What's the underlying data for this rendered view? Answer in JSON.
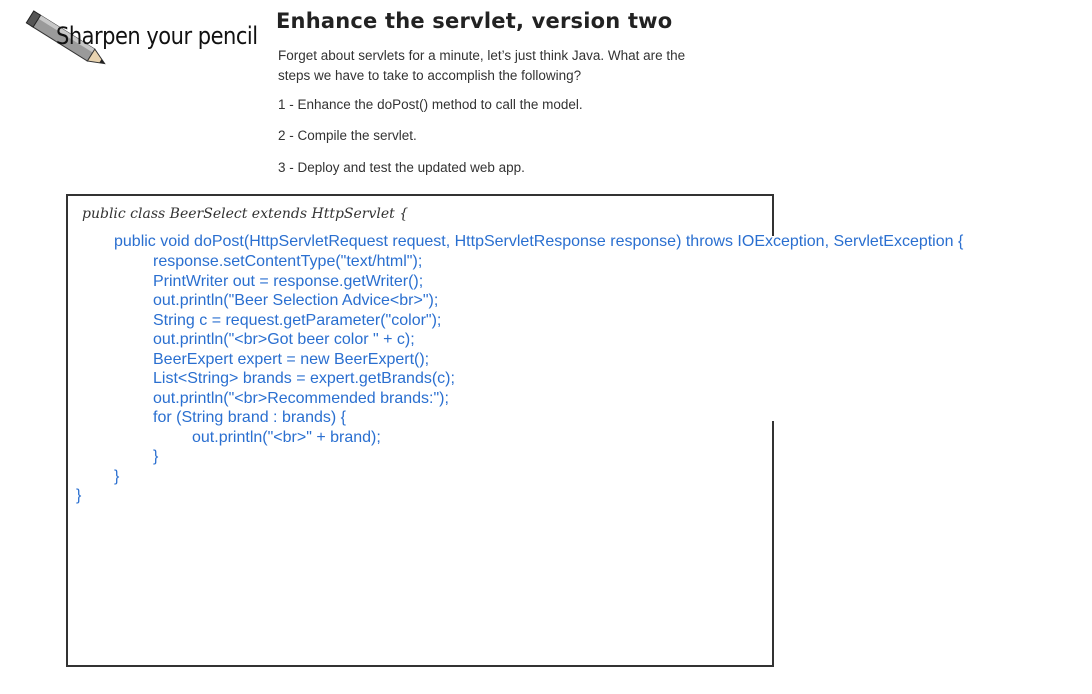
{
  "logo": {
    "text": "Sharpen your pencil"
  },
  "header": {
    "title": "Enhance the servlet, version two"
  },
  "intro": "Forget about servlets for a minute, let’s just think Java.  What are the steps we have to take to accomplish the following?",
  "steps": [
    "1 - Enhance the doPost() method to call the model.",
    "2 - Compile the servlet.",
    "3 - Deploy and test the updated web app."
  ],
  "answer": {
    "class_declaration": "public class BeerSelect extends HttpServlet {",
    "code_lines": [
      "public void doPost(HttpServletRequest request, HttpServletResponse response) throws IOException, ServletException {",
      "response.setContentType(\"text/html\");",
      "PrintWriter out = response.getWriter();",
      "out.println(\"Beer Selection Advice<br>\");",
      "String c = request.getParameter(\"color\");",
      "out.println(\"<br>Got beer color \" + c);",
      "BeerExpert expert = new BeerExpert();",
      "List<String> brands = expert.getBrands(c);",
      "out.println(\"<br>Recommended brands:\");",
      "for (String brand : brands) {",
      "out.println(\"<br>\" + brand);",
      "}",
      "}",
      "}"
    ]
  },
  "colors": {
    "code": "#2a6fd0",
    "text": "#333333",
    "border": "#333333"
  },
  "icons": [
    "pencil-icon"
  ]
}
